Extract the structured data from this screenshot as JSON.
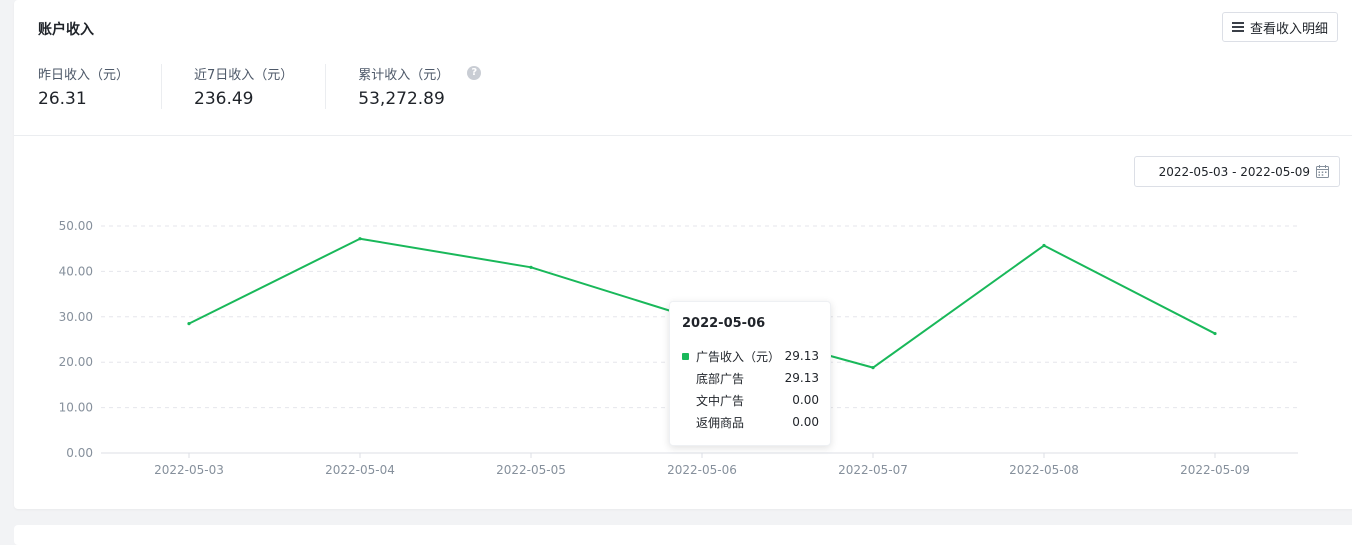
{
  "header": {
    "title": "账户收入",
    "detail_button_label": "查看收入明细"
  },
  "stats": [
    {
      "label": "昨日收入（元）",
      "value": "26.31"
    },
    {
      "label": "近7日收入（元）",
      "value": "236.49"
    },
    {
      "label": "累计收入（元）",
      "value": "53,272.89"
    }
  ],
  "date_range": {
    "value": "2022-05-03 - 2022-05-09"
  },
  "colors": {
    "series": "#19b85a",
    "grid": "#e5e6eb",
    "axis_text": "#86909c"
  },
  "tooltip": {
    "date": "2022-05-06",
    "rows": [
      {
        "label": "广告收入（元）",
        "value": "29.13",
        "marker": true
      },
      {
        "label": "底部广告",
        "value": "29.13",
        "marker": false
      },
      {
        "label": "文中广告",
        "value": "0.00",
        "marker": false
      },
      {
        "label": "返佣商品",
        "value": "0.00",
        "marker": false
      }
    ]
  },
  "chart_data": {
    "type": "line",
    "x": [
      "2022-05-03",
      "2022-05-04",
      "2022-05-05",
      "2022-05-06",
      "2022-05-07",
      "2022-05-08",
      "2022-05-09"
    ],
    "series": [
      {
        "name": "广告收入（元）",
        "values": [
          28.5,
          47.2,
          40.9,
          29.13,
          18.8,
          45.7,
          26.31
        ]
      }
    ],
    "y_ticks": [
      "0.00",
      "10.00",
      "20.00",
      "30.00",
      "40.00",
      "50.00"
    ],
    "ylim": [
      0,
      50
    ],
    "grid": true
  }
}
